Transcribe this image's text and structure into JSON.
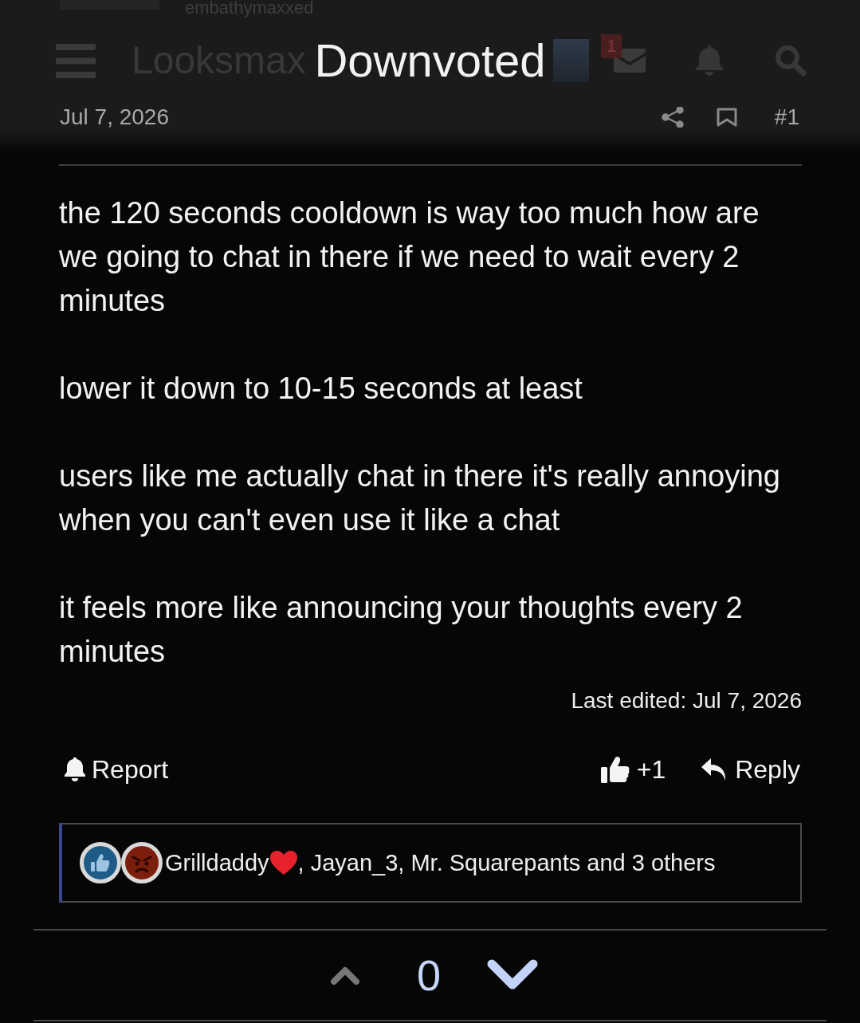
{
  "top_strip": {
    "username": "embathymaxxed"
  },
  "header": {
    "logo": "Looksmax",
    "notification_badge": "1"
  },
  "toast": {
    "message": "Downvoted"
  },
  "post": {
    "date": "Jul 7, 2026",
    "number": "#1",
    "paragraphs": [
      "the 120 seconds cooldown is way too much how are we going to chat in there if we need to wait every 2 minutes",
      "lower it down to 10-15 seconds at least",
      "users like me actually chat in there it's really annoying when you can't even use it like a chat",
      "it feels more like announcing your thoughts every 2 minutes"
    ],
    "last_edited": "Last edited: Jul 7, 2026"
  },
  "actions": {
    "report": "Report",
    "like_count": "+1",
    "reply": "Reply"
  },
  "reactions": {
    "icons": [
      {
        "kind": "like"
      },
      {
        "kind": "angry"
      }
    ],
    "first_user": "Grilldaddy",
    "others": ", Jayan_3, Mr. Squarepants and 3 others"
  },
  "vote": {
    "upvoted": false,
    "score": "0",
    "downvoted": true
  }
}
